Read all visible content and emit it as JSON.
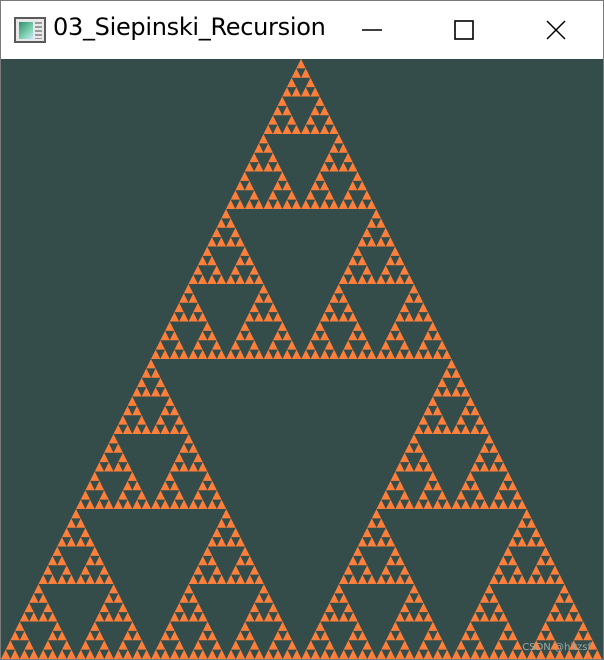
{
  "window": {
    "title": "03_Siepinski_Recursion",
    "icon": "app-window-icon"
  },
  "caption_buttons": {
    "minimize_icon": "minimize-icon",
    "maximize_icon": "maximize-icon",
    "close_icon": "close-icon"
  },
  "canvas": {
    "background_color": "#344d4b",
    "fractal": {
      "type": "sierpinski-triangle",
      "fill_color": "#ff7f3a",
      "recursion_depth": 6
    }
  },
  "watermark": "CSDN @hitzsf"
}
